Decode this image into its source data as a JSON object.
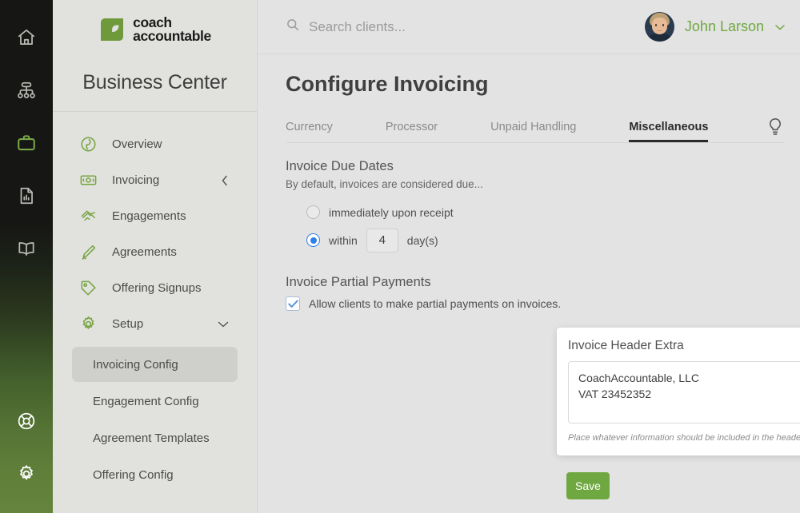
{
  "rail": {
    "items": [
      {
        "name": "home-icon",
        "active": false
      },
      {
        "name": "org-chart-icon",
        "active": false
      },
      {
        "name": "briefcase-icon",
        "active": true
      },
      {
        "name": "report-document-icon",
        "active": false
      },
      {
        "name": "book-icon",
        "active": false
      }
    ],
    "bottom_items": [
      {
        "name": "life-ring-help-icon"
      },
      {
        "name": "gear-settings-icon"
      }
    ],
    "active_color": "#7cae4a",
    "inactive_color": "#b9bbb5"
  },
  "sidebar": {
    "logo": {
      "line1": "coach",
      "line2": "accountable",
      "mark_color": "#6f9a3c"
    },
    "title": "Business Center",
    "items": [
      {
        "label": "Overview",
        "icon": "overview-leaf-icon",
        "caret": ""
      },
      {
        "label": "Invoicing",
        "icon": "money-bill-icon",
        "caret": "‹"
      },
      {
        "label": "Engagements",
        "icon": "handshake-icon",
        "caret": ""
      },
      {
        "label": "Agreements",
        "icon": "pen-signature-icon",
        "caret": ""
      },
      {
        "label": "Offering Signups",
        "icon": "tag-icon",
        "caret": ""
      },
      {
        "label": "Setup",
        "icon": "gear-icon",
        "caret": "⌄"
      }
    ],
    "subitems": [
      {
        "label": "Invoicing Config",
        "active": true
      },
      {
        "label": "Engagement Config",
        "active": false
      },
      {
        "label": "Agreement Templates",
        "active": false
      },
      {
        "label": "Offering Config",
        "active": false
      }
    ]
  },
  "topbar": {
    "search_placeholder": "Search clients...",
    "search_value": "",
    "user_name": "John Larson",
    "user_name_color": "#6ea83f"
  },
  "page": {
    "title": "Configure Invoicing",
    "tabs": [
      {
        "label": "Currency",
        "active": false
      },
      {
        "label": "Processor",
        "active": false
      },
      {
        "label": "Unpaid Handling",
        "active": false
      },
      {
        "label": "Miscellaneous",
        "active": true
      }
    ],
    "tips_icon": "lightbulb-icon"
  },
  "due_dates": {
    "heading": "Invoice Due Dates",
    "subtext": "By default, invoices are considered due...",
    "option_immediate": "immediately upon receipt",
    "option_immediate_selected": false,
    "option_within_prefix": "within",
    "option_within_value": "4",
    "option_within_suffix": "day(s)",
    "option_within_selected": true,
    "accent_color": "#2f80ed"
  },
  "partial_payments": {
    "heading": "Invoice Partial Payments",
    "checkbox_label": "Allow clients to make partial payments on invoices.",
    "checked": true
  },
  "header_extra": {
    "title": "Invoice Header Extra",
    "value": "CoachAccountable, LLC\nVAT 23452352",
    "hint": "Place whatever information should be included in the header of all invoices, e.g. your company name or tax IDs."
  },
  "actions": {
    "save_label": "Save",
    "save_color": "#6fa840"
  }
}
